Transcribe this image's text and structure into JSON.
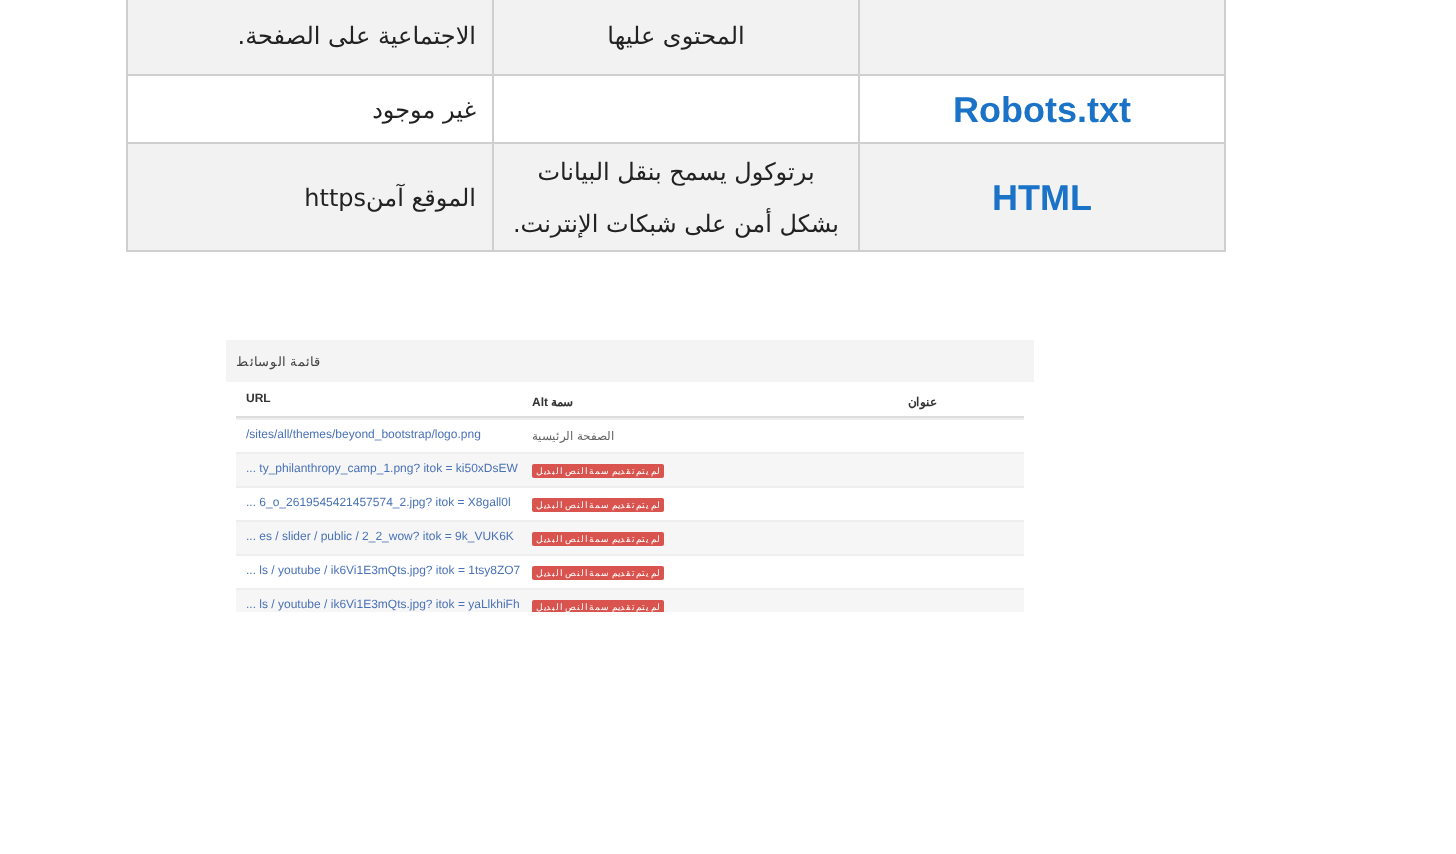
{
  "table": {
    "rows": [
      {
        "label": "",
        "description": "المحتوى عليها",
        "value": "الاجتماعية على الصفحة.",
        "shaded": true
      },
      {
        "label": "Robots.txt",
        "description": "",
        "value": "غير موجود",
        "shaded": false
      },
      {
        "label": "HTML",
        "description": "برتوكول يسمح بنقل البيانات بشكل أمن على شبكات الإنترنت.",
        "value": "الموقع آمنhttps",
        "shaded": true
      }
    ]
  },
  "media_list": {
    "title": "قائمة الوسائط",
    "columns": [
      "عنوان",
      "سمة Alt",
      "URL"
    ],
    "rows": [
      {
        "url": "/sites/all/themes/beyond_bootstrap/logo.png",
        "alt": "الصفحة الرئيسية",
        "kind": "text"
      },
      {
        "url": "... ty_philanthropy_camp_1.png? itok = ki50xDsEW",
        "alt": "لم يتم تقديم سمة النص البديل",
        "kind": "badge"
      },
      {
        "url": "... 6_o_2619545421457574_2.jpg? itok = X8gall0l",
        "alt": "لم يتم تقديم سمة النص البديل",
        "kind": "badge"
      },
      {
        "url": "... es / slider / public / 2_2_wow? itok = 9k_VUK6K",
        "alt": "لم يتم تقديم سمة النص البديل",
        "kind": "badge"
      },
      {
        "url": "... ls / youtube / ik6Vi1E3mQts.jpg? itok = 1tsy8ZO7",
        "alt": "لم يتم تقديم سمة النص البديل",
        "kind": "badge"
      },
      {
        "url": "... ls / youtube / ik6Vi1E3mQts.jpg? itok = yaLlkhiFh",
        "alt": "لم يتم تقديم سمة النص البديل",
        "kind": "badge"
      }
    ]
  }
}
